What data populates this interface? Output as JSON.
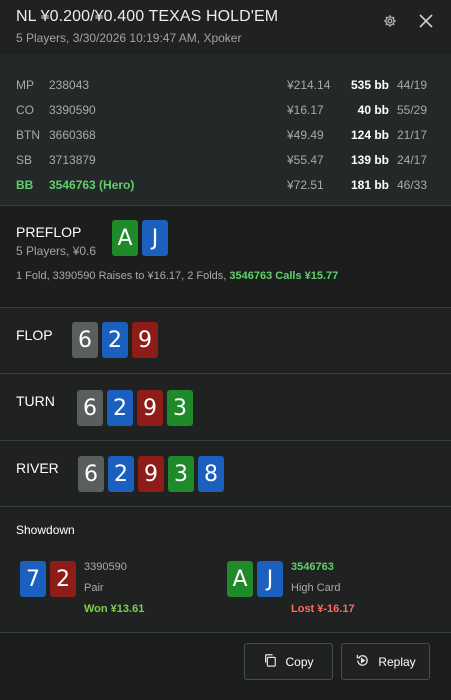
{
  "header": {
    "title": "NL ¥0.200/¥0.400 TEXAS HOLD'EM",
    "subtitle": "5 Players, 3/30/2026 10:19:47 AM, Xpoker",
    "settings_icon": "gear-icon",
    "close_icon": "close-icon"
  },
  "players": [
    {
      "pos": "MP",
      "id": "238043",
      "money": "¥214.14",
      "bb": "535 bb",
      "ratio": "44/19",
      "hero": false
    },
    {
      "pos": "CO",
      "id": "3390590",
      "money": "¥16.17",
      "bb": "40 bb",
      "ratio": "55/29",
      "hero": false
    },
    {
      "pos": "BTN",
      "id": "3660368",
      "money": "¥49.49",
      "bb": "124 bb",
      "ratio": "21/17",
      "hero": false
    },
    {
      "pos": "SB",
      "id": "3713879",
      "money": "¥55.47",
      "bb": "139 bb",
      "ratio": "24/17",
      "hero": false
    },
    {
      "pos": "BB",
      "id": "3546763 (Hero)",
      "money": "¥72.51",
      "bb": "181 bb",
      "ratio": "46/33",
      "hero": true
    }
  ],
  "preflop": {
    "label": "PREFLOP",
    "sub": "5 Players, ¥0.6",
    "cards": [
      {
        "r": "A",
        "c": "#1f8a2a"
      },
      {
        "r": "J",
        "c": "#1b5fbf"
      }
    ],
    "actions_plain": "1 Fold, 3390590 Raises to ¥16.17, 2 Folds, ",
    "actions_hero": "3546763 Calls ¥15.77"
  },
  "flop": {
    "label": "FLOP",
    "cards": [
      {
        "r": "6",
        "c": "#5b5e5e"
      },
      {
        "r": "2",
        "c": "#1b5fbf"
      },
      {
        "r": "9",
        "c": "#8e1d17"
      }
    ]
  },
  "turn": {
    "label": "TURN",
    "cards": [
      {
        "r": "6",
        "c": "#5b5e5e"
      },
      {
        "r": "2",
        "c": "#1b5fbf"
      },
      {
        "r": "9",
        "c": "#8e1d17"
      },
      {
        "r": "3",
        "c": "#1f8a2a"
      }
    ]
  },
  "river": {
    "label": "RIVER",
    "cards": [
      {
        "r": "6",
        "c": "#5b5e5e"
      },
      {
        "r": "2",
        "c": "#1b5fbf"
      },
      {
        "r": "9",
        "c": "#8e1d17"
      },
      {
        "r": "3",
        "c": "#1f8a2a"
      },
      {
        "r": "8",
        "c": "#1b5fbf"
      }
    ]
  },
  "showdown": {
    "title": "Showdown",
    "p1": {
      "id": "3390590",
      "hand": "Pair",
      "result": "Won ¥13.61",
      "cards": [
        {
          "r": "7",
          "c": "#1b5fbf"
        },
        {
          "r": "2",
          "c": "#8e1d17"
        }
      ]
    },
    "p2": {
      "id": "3546763",
      "hand": "High Card",
      "result": "Lost ¥-16.17",
      "cards": [
        {
          "r": "A",
          "c": "#1f8a2a"
        },
        {
          "r": "J",
          "c": "#1b5fbf"
        }
      ]
    }
  },
  "footer": {
    "copy_label": "Copy",
    "replay_label": "Replay",
    "copy_icon": "copy-icon",
    "replay_icon": "replay-icon"
  }
}
